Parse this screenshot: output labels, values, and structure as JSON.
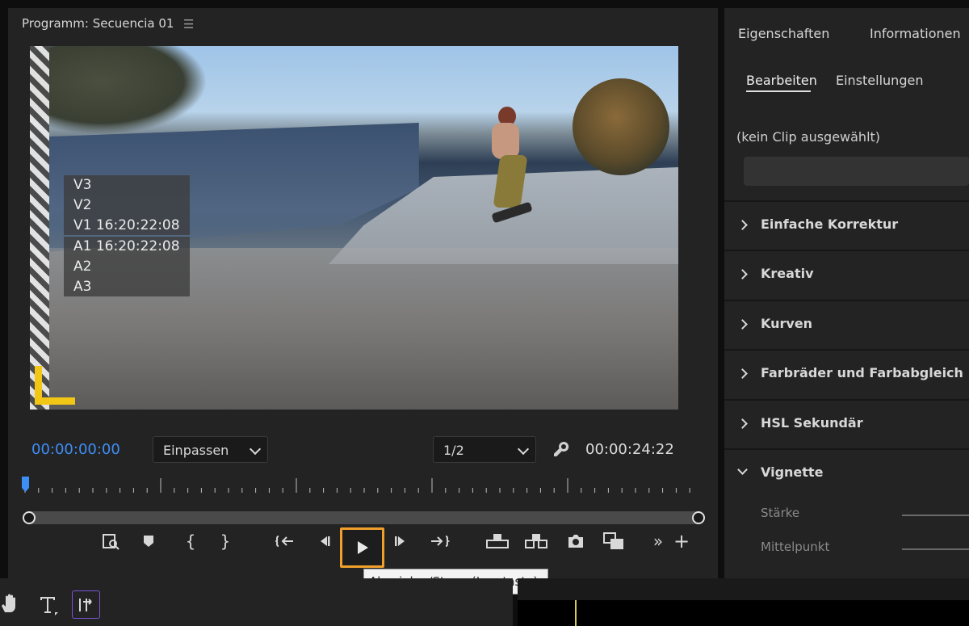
{
  "program_monitor": {
    "title": "Programm: Secuencia 01",
    "tracks_video": [
      "V3",
      "V2",
      "V1 16:20:22:08"
    ],
    "tracks_audio": [
      "A1 16:20:22:08",
      "A2",
      "A3"
    ],
    "timecode_current": "00:00:00:00",
    "timecode_current_color": "#3e8ef7",
    "zoom_dropdown": "Einpassen",
    "resolution_dropdown": "1/2",
    "timecode_duration": "00:00:24:22",
    "tooltip": "Abspielen/Stopp (Leertaste)",
    "highlight_color": "#f0a02a"
  },
  "lumetri": {
    "tabs": [
      "Eigenschaften",
      "Informationen"
    ],
    "subtabs": [
      "Bearbeiten",
      "Einstellungen"
    ],
    "no_clip": "(kein Clip ausgewählt)",
    "sections": [
      {
        "label": "Einfache Korrektur"
      },
      {
        "label": "Kreativ"
      },
      {
        "label": "Kurven"
      },
      {
        "label": "Farbräder und Farbabgleich"
      },
      {
        "label": "HSL Sekundär"
      },
      {
        "label": "Vignette"
      }
    ],
    "vignette_params": [
      "Stärke",
      "Mittelpunkt"
    ]
  },
  "tools": {
    "icons": [
      "hand-icon",
      "type-tool-icon",
      "track-select-icon"
    ]
  }
}
